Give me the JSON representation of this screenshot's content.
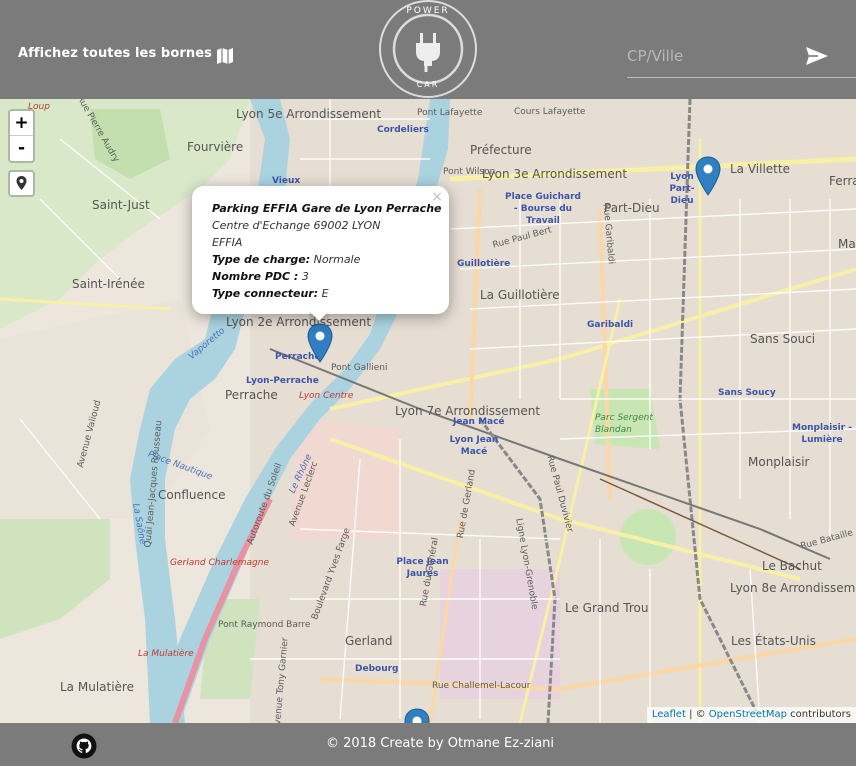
{
  "header": {
    "show_all_label": "Affichez toutes les bornes",
    "logo_top": "POWER",
    "logo_bottom": "CAR",
    "search_placeholder": "CP/Ville",
    "search_value": ""
  },
  "map": {
    "zoom_in": "+",
    "zoom_out": "-",
    "labels": {
      "lyon5": "Lyon 5e Arrondissement",
      "fourviere": "Fourvière",
      "saintjust": "Saint-Just",
      "saintirenee": "Saint-Irénée",
      "lyon2": "Lyon 2e Arrondissement",
      "perrache": "Perrache",
      "confluence": "Confluence",
      "lamulatiere": "La Mulatière",
      "gerland": "Gerland",
      "lyon7": "Lyon 7e Arrondissement",
      "laguillotiere": "La Guillotière",
      "lyon3": "Lyon 3e Arrondissement",
      "prefecture": "Préfecture",
      "partdieu": "Part-Dieu",
      "lavillette": "La Villette",
      "sanssouci": "Sans Souci",
      "monplaisir": "Monplaisir",
      "lebachut": "Le Bachut",
      "lyon8": "Lyon 8e Arrondissement",
      "legrandtrou": "Le Grand Trou",
      "etatsunis": "Les États-Unis",
      "ferr": "Ferra",
      "ma": "Ma",
      "pontlafayette": "Pont Lafayette",
      "pontwilson": "Pont Wilson",
      "pontgallieni": "Pont Gallieni",
      "pontraymondbarre": "Pont Raymond Barre",
      "coursLafayette": "Cours Lafayette",
      "cordeliers": "Cordeliers",
      "guichard": "Place Guichard - Bourse du Travail",
      "guillotiere_stop": "Guillotière",
      "garibaldi": "Garibaldi",
      "jeanmace": "Jean Macé",
      "lyonjeanmace": "Lyon Jean Macé",
      "placejeanjaures": "Place Jean Jaurès",
      "debourg": "Debourg",
      "lyonperrache": "Lyon-Perrache",
      "lyoncentre": "Lyon Centre",
      "gerlandcharlemagne": "Gerland Charlemagne",
      "lamulatiere_stop": "La Mulatière",
      "lyonpartdieu": "Lyon Part-Dieu",
      "sanssouci_stop": "Sans Soucy",
      "monplaisirlumiere": "Monplaisir - Lumière",
      "parcsergent": "Parc Sergent Blandan",
      "ruegaribaldi": "Rue Garibaldi",
      "ruepaulbert": "Rue Paul Bert",
      "avenueleclerc": "Avenue Leclerc",
      "autoroutesoleil": "Autoroute du Soleil",
      "lerhone": "Le Rhône",
      "lasaone": "La Saône",
      "bdyvesfarge": "Boulevard Yves Farge",
      "ruedegerland": "Rue de Gerland",
      "ruechallemel": "Rue Challemel-Lacour",
      "avtonygarnier": "Avenue Tony Garnier",
      "ruebataille": "Rue Bataille",
      "avlaloud": "Avenue Valioud",
      "quaijjrousseau": "Quai Jean-Jacques Rousseau",
      "placenautique": "Place Nautique",
      "rueaudry": "Rue Pierre Audry",
      "ruepaulduvivier": "Rue Paul Duvivier",
      "vaporetto": "Vaporetto",
      "perrache_stop": "Perrache",
      "vieux": "Vieux",
      "loup": "Loup",
      "garegenerale": "Rue du Général",
      "ligne_grenoble": "Ligne Lyon-Grenoble"
    },
    "popup": {
      "close": "×",
      "title": "Parking EFFIA Gare de Lyon Perrache",
      "address": "Centre d'Echange 69002 LYON",
      "operator": "EFFIA",
      "charge_type_label": "Type de charge:",
      "charge_type_value": "Normale",
      "pdc_label": "Nombre PDC :",
      "pdc_value": "3",
      "connector_label": "Type connecteur:",
      "connector_value": "E"
    },
    "attribution": {
      "leaflet": "Leaflet",
      "separator": " | © ",
      "osm": "OpenStreetMap",
      "contributors": " contributors"
    },
    "marker_color": "#2f7fc1"
  },
  "footer": {
    "copyright": "© 2018 Create by Otmane Ez-ziani"
  },
  "colors": {
    "header_bg": "#7b7b7b",
    "map_bg": "#ece6dd",
    "river": "#aad3df",
    "park": "#c8e6b4",
    "road_yellow": "#f7f0a6",
    "road_orange": "#fcd6a4",
    "motorway": "#e892a2"
  }
}
